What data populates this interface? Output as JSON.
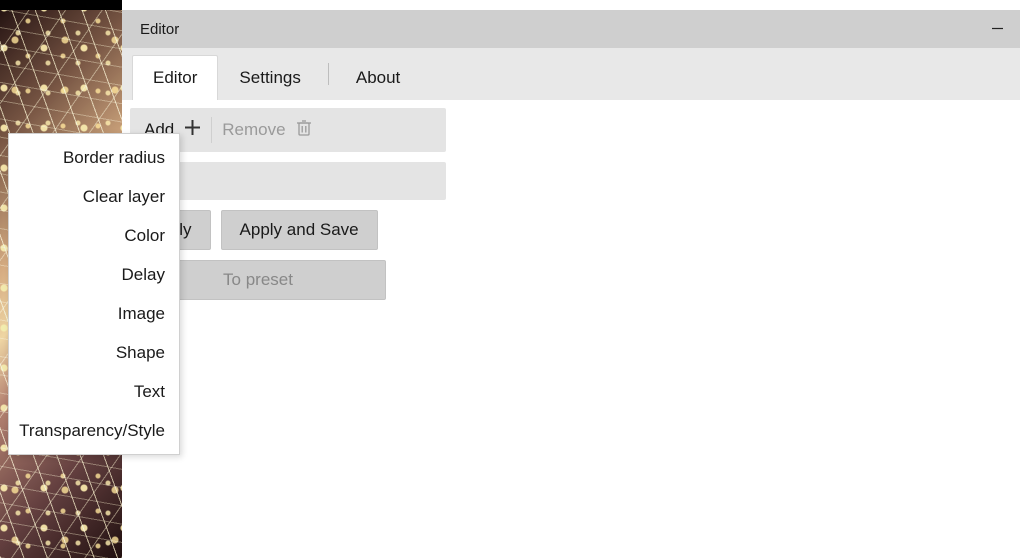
{
  "window": {
    "title": "Editor"
  },
  "tabs": {
    "editor": "Editor",
    "settings": "Settings",
    "about": "About",
    "active": "editor"
  },
  "toolbar": {
    "add_label": "Add",
    "remove_label": "Remove"
  },
  "buttons": {
    "apply": "Apply",
    "apply_and_save": "Apply and Save",
    "to_preset": "To preset"
  },
  "add_menu": {
    "items": [
      "Border radius",
      "Clear layer",
      "Color",
      "Delay",
      "Image",
      "Shape",
      "Text",
      "Transparency/Style"
    ]
  }
}
